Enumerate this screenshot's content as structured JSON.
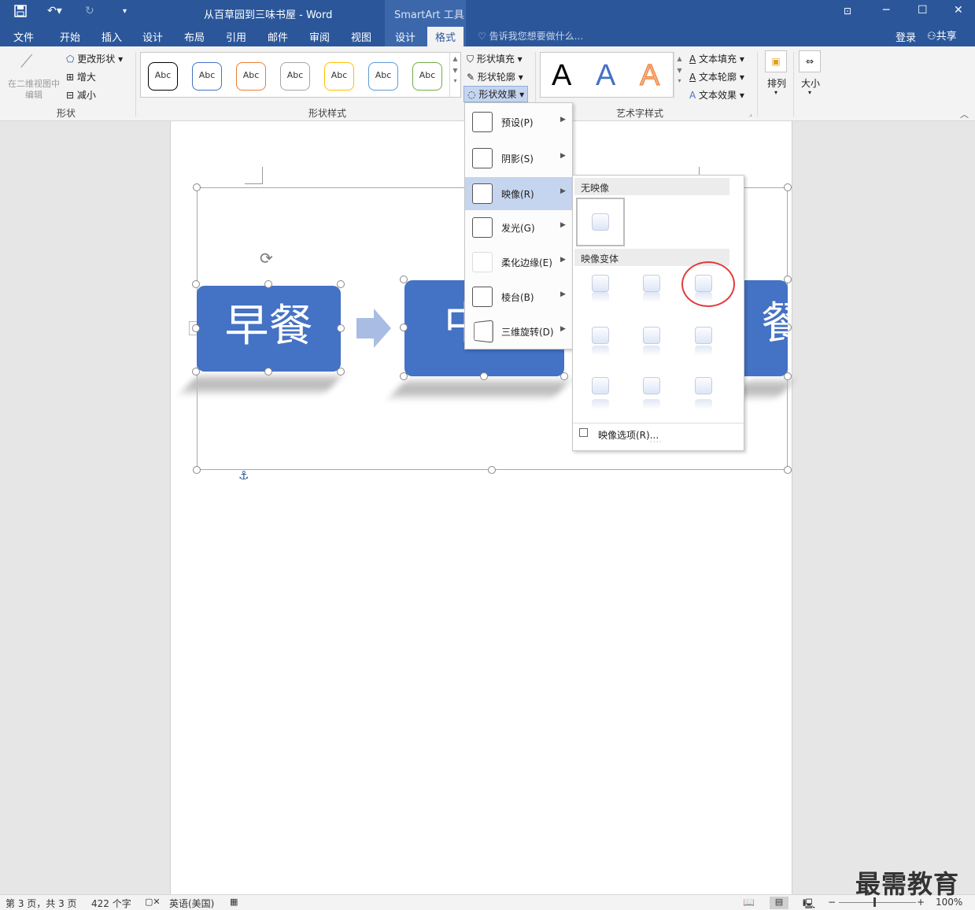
{
  "title": {
    "doc_name": "从百草园到三味书屋 - Word",
    "context_tab": "SmartArt 工具",
    "restore_icon": "ribbon-display-icon",
    "min_icon": "minimize-icon",
    "max_icon": "maximize-icon",
    "close_icon": "close-icon"
  },
  "qat": {
    "save_icon": "save-icon",
    "undo_icon": "undo-icon",
    "redo_icon": "redo-icon",
    "customize_icon": "customize-icon"
  },
  "tabs": {
    "file": "文件",
    "home": "开始",
    "insert": "插入",
    "design": "设计",
    "layout": "布局",
    "references": "引用",
    "mailings": "邮件",
    "review": "审阅",
    "view": "视图",
    "sa_design": "设计",
    "sa_format": "格式",
    "tell_me": "告诉我您想要做什么...",
    "login": "登录",
    "share": "共享"
  },
  "ribbon": {
    "shapes": {
      "edit_2d": "在二维视图中编辑",
      "change_shape": "更改形状",
      "larger": "增大",
      "smaller": "减小",
      "label": "形状"
    },
    "shape_styles": {
      "items": [
        "Abc",
        "Abc",
        "Abc",
        "Abc",
        "Abc",
        "Abc",
        "Abc"
      ],
      "colors": [
        "#000000",
        "#4472c4",
        "#ed7d31",
        "#a5a5a5",
        "#ffc000",
        "#5b9bd5",
        "#70ad47"
      ],
      "label": "形状样式",
      "fill": "形状填充",
      "outline": "形状轮廓",
      "effects": "形状效果"
    },
    "wordart": {
      "letters": [
        "A",
        "A",
        "A"
      ],
      "label": "艺术字样式",
      "text_fill": "文本填充",
      "text_outline": "文本轮廓",
      "text_effects": "文本效果"
    },
    "arrange": "排列",
    "size": "大小"
  },
  "smartart": {
    "box1": "早餐",
    "box2": "中",
    "box3": "餐"
  },
  "effects_menu": [
    {
      "label": "预设(P)",
      "highlighted": false
    },
    {
      "label": "阴影(S)",
      "highlighted": false
    },
    {
      "label": "映像(R)",
      "highlighted": true
    },
    {
      "label": "发光(G)",
      "highlighted": false
    },
    {
      "label": "柔化边缘(E)",
      "highlighted": false
    },
    {
      "label": "棱台(B)",
      "highlighted": false
    },
    {
      "label": "三维旋转(D)",
      "highlighted": false
    }
  ],
  "reflection_submenu": {
    "no_reflection": "无映像",
    "variants": "映像变体",
    "options": "映像选项(R)..."
  },
  "status": {
    "page": "第 3 页，共 3 页",
    "words": "422 个字",
    "language": "英语(美国)",
    "zoom": "100%"
  },
  "watermark": "最需教育"
}
